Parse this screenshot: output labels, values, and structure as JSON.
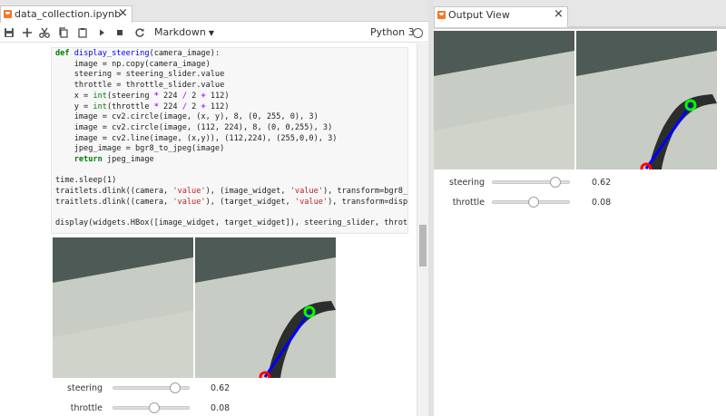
{
  "notebook_tab": {
    "title": "data_collection.ipynb",
    "close_glyph": "×"
  },
  "toolbar": {
    "icons": [
      "save-icon",
      "add-icon",
      "cut-icon",
      "copy-icon",
      "paste-icon",
      "run-icon",
      "stop-icon",
      "restart-icon"
    ],
    "cell_type": "Markdown",
    "kernel_name": "Python 3"
  },
  "code_cell": {
    "lines": [
      "def display_steering(camera_image):",
      "    image = np.copy(camera_image)",
      "    steering = steering_slider.value",
      "    throttle = throttle_slider.value",
      "    x = int(steering * 224 / 2 + 112)",
      "    y = int(throttle * 224 / 2 + 112)",
      "    image = cv2.circle(image, (x, y), 8, (0, 255, 0), 3)",
      "    image = cv2.circle(image, (112, 224), 8, (0, 0,255), 3)",
      "    image = cv2.line(image, (x,y)), (112,224), (255,0,0), 3)",
      "    jpeg_image = bgr8_to_jpeg(image)",
      "    return jpeg_image",
      "",
      "time.sleep(1)",
      "traitlets.dlink((camera, 'value'), (image_widget, 'value'), transform=bgr8_to_j",
      "traitlets.dlink((camera, 'value'), (target_widget, 'value'), transform=display_",
      "",
      "display(widgets.HBox([image_widget, target_widget]), steering_slider, throttle_"
    ]
  },
  "notebook_output": {
    "steering": {
      "label": "steering",
      "value": "0.62",
      "fraction": 0.81
    },
    "throttle": {
      "label": "throttle",
      "value": "0.08",
      "fraction": 0.54
    }
  },
  "output_view": {
    "title": "Output View",
    "close_glyph": "×",
    "steering": {
      "label": "steering",
      "value": "0.62",
      "fraction": 0.81
    },
    "throttle": {
      "label": "throttle",
      "value": "0.08",
      "fraction": 0.54
    }
  },
  "colors": {
    "jupyter_orange": "#f37726",
    "target_green": "#00ff00",
    "base_red": "#ff0000",
    "line_blue": "#0000ff"
  }
}
